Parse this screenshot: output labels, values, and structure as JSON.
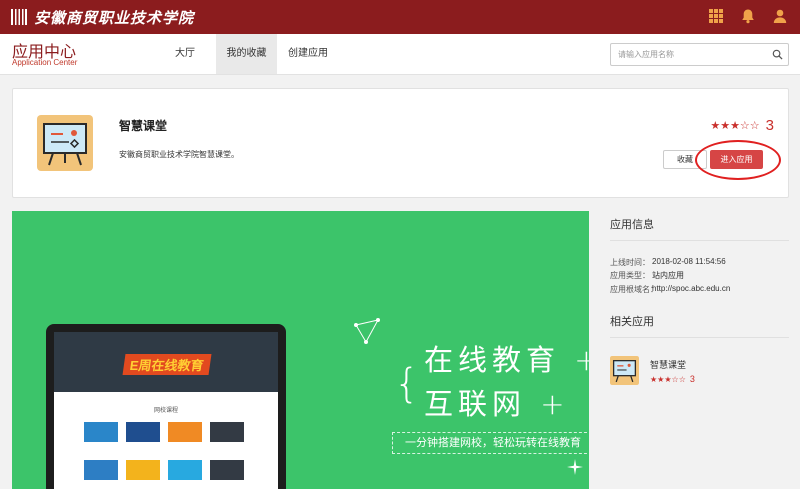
{
  "topbar": {
    "school_name": "安徽商贸职业技术学院",
    "icons": [
      "grid-icon",
      "bell-icon",
      "user-icon"
    ],
    "color": "#8b1c1e"
  },
  "brand": {
    "title": "应用中心",
    "subtitle": "Application Center"
  },
  "nav": {
    "tabs": [
      {
        "label": "大厅",
        "active": false
      },
      {
        "label": "我的收藏",
        "active": true
      },
      {
        "label": "创建应用",
        "active": false
      }
    ]
  },
  "search": {
    "placeholder": "请输入应用名称",
    "value": ""
  },
  "app": {
    "name": "智慧课堂",
    "description": "安徽商贸职业技术学院智慧课堂。",
    "rating_stars": "★★★☆☆",
    "rating_value": "3",
    "favorite_label": "收藏",
    "enter_label": "进入应用",
    "accent_color": "#d64545"
  },
  "banner": {
    "background": "#3cc46a",
    "headline_line1": "在线教育 +",
    "headline_line2": "互联网 +",
    "tagline": "一分钟搭建网校，轻松玩转在线教育",
    "screen_hero_text": "E周在线教育",
    "screen_subtitle": "网校课程"
  },
  "sidebar": {
    "info_heading": "应用信息",
    "info": [
      {
        "label": "上线时间：",
        "value": "2018-02-08 11:54:56"
      },
      {
        "label": "应用类型：",
        "value": "站内应用"
      },
      {
        "label": "应用根域名：",
        "value": "http://spoc.abc.edu.cn"
      }
    ],
    "related_heading": "相关应用",
    "related": [
      {
        "name": "智慧课堂",
        "stars": "★★★☆☆",
        "rating": "3"
      }
    ]
  }
}
